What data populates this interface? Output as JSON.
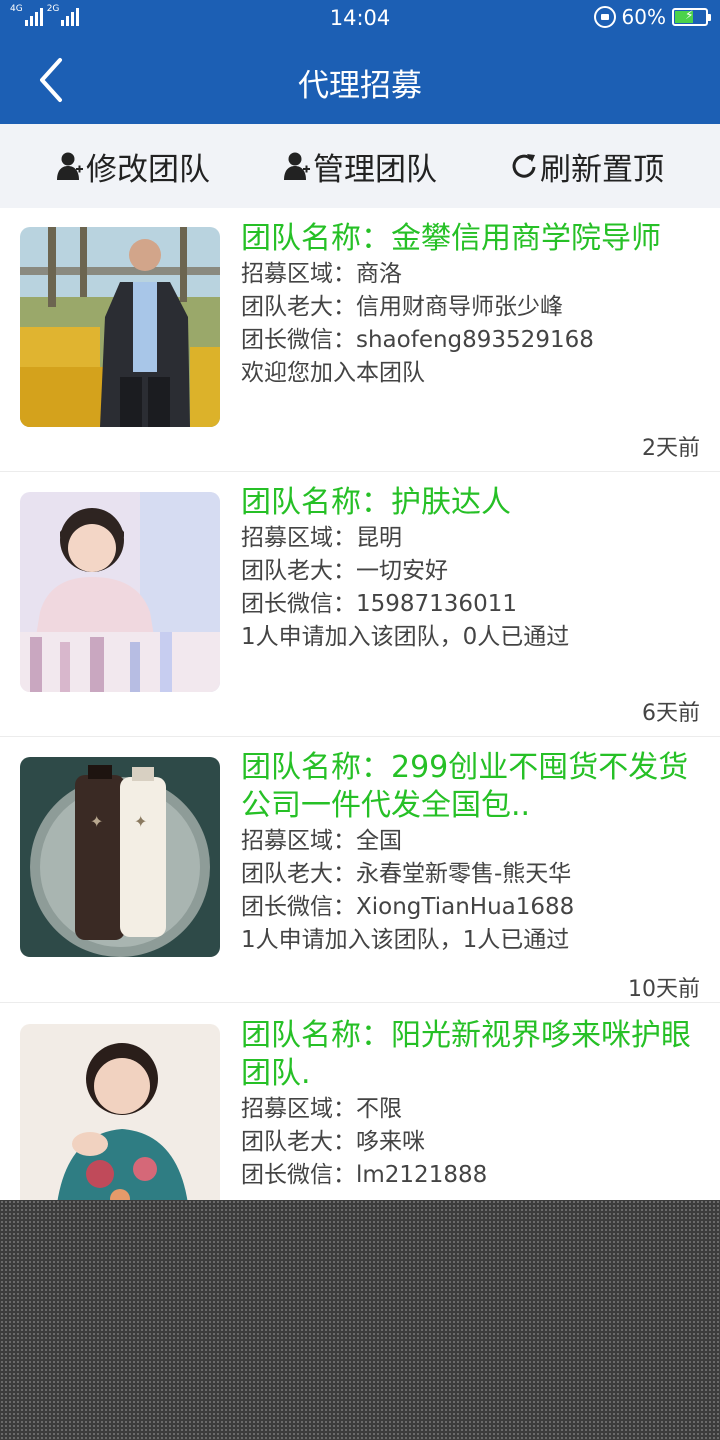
{
  "status_bar": {
    "network_labels": [
      "4G",
      "2G"
    ],
    "time": "14:04",
    "battery": "60%",
    "battery_level": 0.6
  },
  "nav": {
    "title": "代理招募",
    "back_icon": "chevron-left-icon"
  },
  "toolbar": {
    "edit_team": "修改团队",
    "manage_team": "管理团队",
    "refresh_top": "刷新置顶",
    "icons": [
      "person-icon",
      "person-icon",
      "refresh-icon"
    ]
  },
  "teams": [
    {
      "name": "团队名称：金攀信用商学院导师",
      "region": "招募区域：商洛",
      "leader": "团队老大：信用财商导师张少峰",
      "wechat": "团长微信：shaofeng893529168",
      "note": "欢迎您加入本团队",
      "time": "2天前"
    },
    {
      "name": "团队名称：护肤达人",
      "region": "招募区域：昆明",
      "leader": "团队老大：一切安好",
      "wechat": "团长微信：15987136011",
      "note": "1人申请加入该团队，0人已通过",
      "time": "6天前"
    },
    {
      "name": "团队名称：299创业不囤货不发货公司一件代发全国包..",
      "region": "招募区域：全国",
      "leader": "团队老大：永春堂新零售-熊天华",
      "wechat": "团长微信：XiongTianHua1688",
      "note": "1人申请加入该团队，1人已通过",
      "time": "10天前"
    },
    {
      "name": "团队名称：阳光新视界哆来咪护眼团队.",
      "region": "招募区域：不限",
      "leader": "团队老大：哆来咪",
      "wechat": "团长微信：lm2121888"
    }
  ],
  "colors": {
    "header": "#1c5fb4",
    "team_name": "#26c026",
    "toolbar_bg": "#f1f3f7"
  }
}
